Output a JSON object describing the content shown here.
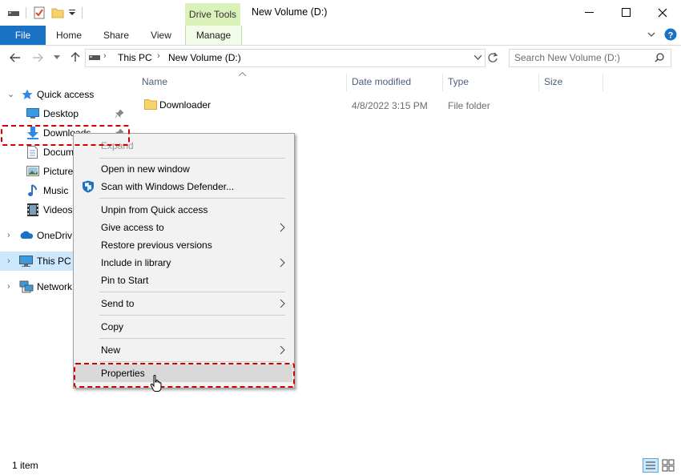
{
  "window": {
    "title": "New Volume (D:)",
    "contextual_tab_group": "Drive Tools"
  },
  "ribbon": {
    "tabs": [
      "File",
      "Home",
      "Share",
      "View",
      "Manage"
    ]
  },
  "address": {
    "crumbs": [
      "This PC",
      "New Volume (D:)"
    ],
    "search_placeholder": "Search New Volume (D:)"
  },
  "nav": {
    "items": [
      {
        "label": "Quick access",
        "icon": "star-icon"
      },
      {
        "label": "Desktop",
        "icon": "desktop-icon"
      },
      {
        "label": "Downloads",
        "icon": "download-arrow-icon"
      },
      {
        "label": "Docum",
        "icon": "document-icon"
      },
      {
        "label": "Picture",
        "icon": "pictures-icon"
      },
      {
        "label": "Music",
        "icon": "music-note-icon"
      },
      {
        "label": "Videos",
        "icon": "film-icon"
      },
      {
        "label": "OneDriv",
        "icon": "cloud-icon"
      },
      {
        "label": "This PC",
        "icon": "computer-icon"
      },
      {
        "label": "Network",
        "icon": "network-icon"
      }
    ]
  },
  "content": {
    "columns": [
      "Name",
      "Date modified",
      "Type",
      "Size"
    ],
    "rows": [
      {
        "name": "Downloader",
        "date": "4/8/2022 3:15 PM",
        "type": "File folder",
        "size": ""
      }
    ]
  },
  "context_menu": {
    "items": {
      "expand": "Expand",
      "open_new_window": "Open in new window",
      "scan_defender": "Scan with Windows Defender...",
      "unpin": "Unpin from Quick access",
      "give_access": "Give access to",
      "restore": "Restore previous versions",
      "include_library": "Include in library",
      "pin_start": "Pin to Start",
      "send_to": "Send to",
      "copy": "Copy",
      "new": "New",
      "properties": "Properties"
    }
  },
  "status": {
    "item_count": "1 item"
  },
  "colors": {
    "file_tab": "#1a72c4",
    "contextual_tab": "#daf1b9",
    "selection": "#cce8ff",
    "highlight_border": "#d10000",
    "folder": "#f6d36b"
  }
}
